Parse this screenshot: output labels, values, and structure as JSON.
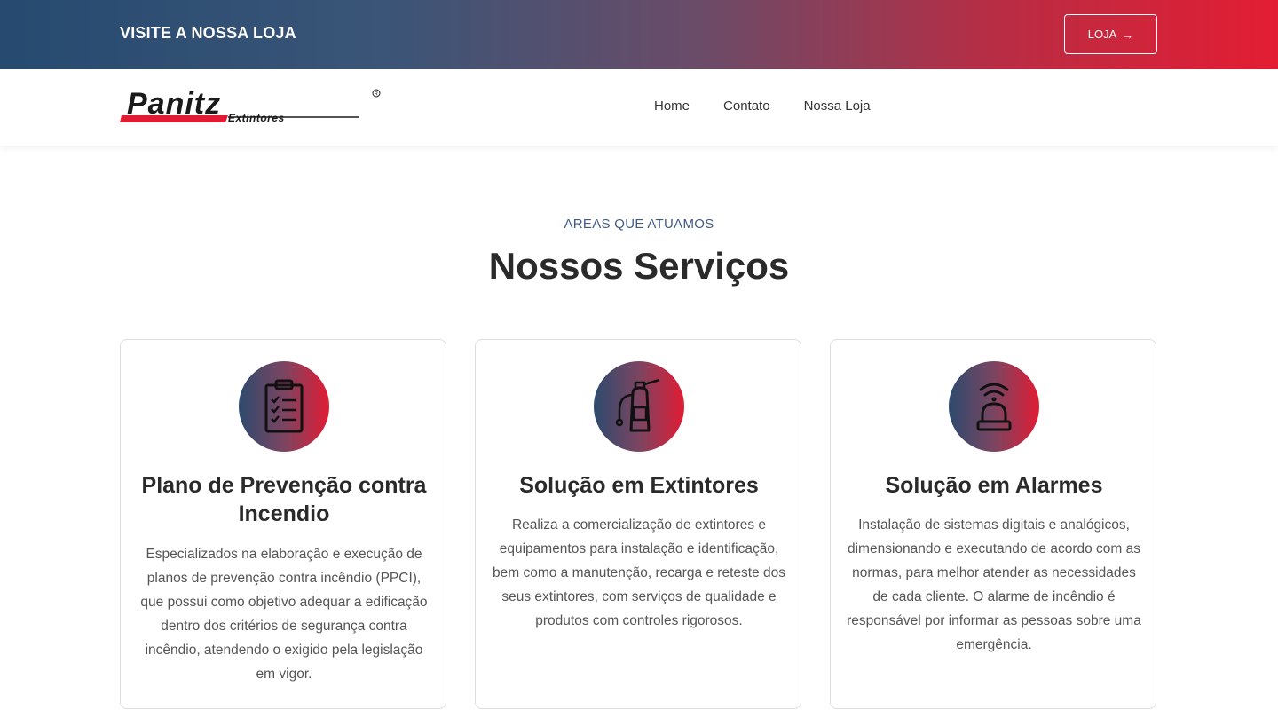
{
  "topbar": {
    "promo_text": "VISITE A NOSSA LOJA",
    "shop_button_label": "LOJA",
    "shop_button_icon": "arrow-right-icon"
  },
  "header": {
    "logo_alt": "Panitz Extintores",
    "nav": [
      {
        "label": "Home"
      },
      {
        "label": "Contato"
      },
      {
        "label": "Nossa Loja"
      }
    ]
  },
  "services": {
    "eyebrow": "AREAS QUE ATUAMOS",
    "title": "Nossos Serviços",
    "cards": [
      {
        "icon": "checklist-clipboard-icon",
        "title": "Plano de Prevenção contra Incendio",
        "description": "Especializados na elaboração e execução de planos de prevenção contra incêndio (PPCI), que possui como objetivo adequar a edificação dentro dos critérios de segurança contra incêndio, atendendo o exigido pela legislação em vigor."
      },
      {
        "icon": "fire-extinguisher-icon",
        "title": "Solução em Extintores",
        "description": "Realiza a comercialização de extintores e equipamentos para instalação e identificação, bem como a manutenção, recarga e reteste dos seus extintores, com serviços de qualidade e produtos com controles rigorosos."
      },
      {
        "icon": "alarm-siren-icon",
        "title": "Solução em Alarmes",
        "description": "Instalação de sistemas digitais e analógicos, dimensionando e executando de acordo com as normas, para melhor atender as necessidades de cada cliente. O alarme de incêndio é responsável por informar as pessoas sobre uma emergência."
      }
    ]
  },
  "colors": {
    "gradient_start": "#264a70",
    "gradient_end": "#e31d33",
    "eyebrow": "#3f5a86",
    "logo_red": "#e21b34"
  }
}
